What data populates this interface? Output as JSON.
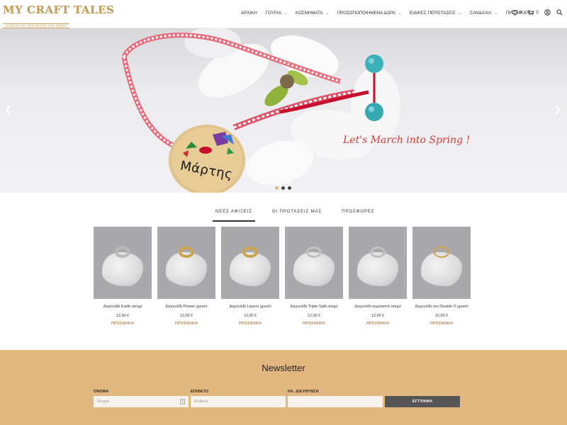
{
  "logo": {
    "title": "MY CRAFT TALES",
    "subtitle": "HANDMADE CREATIONS AND MORE"
  },
  "nav": {
    "items": [
      {
        "label": "ΑΡΧΙΚΗ",
        "dropdown": false
      },
      {
        "label": "ΓΟΥΡΙΑ",
        "dropdown": true
      },
      {
        "label": "ΚΟΣΜΗΜΑΤΑ",
        "dropdown": true
      },
      {
        "label": "ΠΡΟΣΩΠΟΠΟΙΗΜΕΝΑ ΔΩΡΑ",
        "dropdown": true
      },
      {
        "label": "ΕΙΔΙΚΕΣ ΠΕΡΙΣΤΑΣΕΙΣ",
        "dropdown": true
      },
      {
        "label": "ΣΑΝΔΑΛΙΑ",
        "dropdown": true
      },
      {
        "label": "ΠΡΟΣΦΟΡΕΣ",
        "dropdown": true
      }
    ],
    "wishlist_count": "0",
    "cart_count": "0",
    "icons": [
      "heart-icon",
      "cart-icon",
      "user-icon",
      "search-icon"
    ]
  },
  "hero": {
    "caption": "Let's March into Spring !",
    "tag_text": "Μάρτης",
    "slide_count": 3,
    "active_slide": 1
  },
  "tabs": [
    {
      "label": "ΝΕΕΣ ΑΦΙΞΕΙΣ",
      "active": true
    },
    {
      "label": "ΟΙ ΠΡΟΤΑΣΕΙΣ ΜΑΣ",
      "active": false
    },
    {
      "label": "ΠΡΟΣΦΟΡΕΣ",
      "active": false
    }
  ],
  "products": [
    {
      "name": "Δαχτυλίδι Earth ασημί",
      "price": "12,00 €",
      "action": "ΠΡΟΣΘΗΚΗ",
      "ring_color": "#b8b8b8"
    },
    {
      "name": "Δαχτυλίδι Flower χρυσό",
      "price": "12,00 €",
      "action": "ΠΡΟΣΘΗΚΗ",
      "ring_color": "#c9a44a"
    },
    {
      "name": "Δαχτυλίδι Layers χρυσό",
      "price": "12,00 €",
      "action": "ΠΡΟΣΘΗΚΗ",
      "ring_color": "#c9a44a"
    },
    {
      "name": "Δαχτυλίδι Triple Split ασημί",
      "price": "12,00 €",
      "action": "ΠΡΟΣΘΗΚΗ",
      "ring_color": "#c0c0c0"
    },
    {
      "name": "Δαχτυλίδι κυματιστό ασημί",
      "price": "12,00 €",
      "action": "ΠΡΟΣΘΗΚΗ",
      "ring_color": "#c0c0c0"
    },
    {
      "name": "Δαχτυλίδι σετ Double X χρυσό",
      "price": "15,00 €",
      "action": "ΠΡΟΣΘΗΚΗ",
      "ring_color": "#c9a44a"
    }
  ],
  "newsletter": {
    "title": "Newsletter",
    "fields": [
      {
        "label": "ΟΝΟΜΑ",
        "placeholder": "Όνομα"
      },
      {
        "label": "ΕΠΙΘΕΤΟ",
        "placeholder": "Επίθετο"
      },
      {
        "label": "ΗΛ. ΔΙΕΥΘΥΝΣΗ",
        "placeholder": ""
      }
    ],
    "submit_label": "ΕΓΓΡΑΦΗ"
  },
  "colors": {
    "gold": "#c9a05b",
    "newsletter_bg": "#e2b880",
    "add_to_cart": "#c47f36",
    "caption_red": "#d23a3a"
  }
}
